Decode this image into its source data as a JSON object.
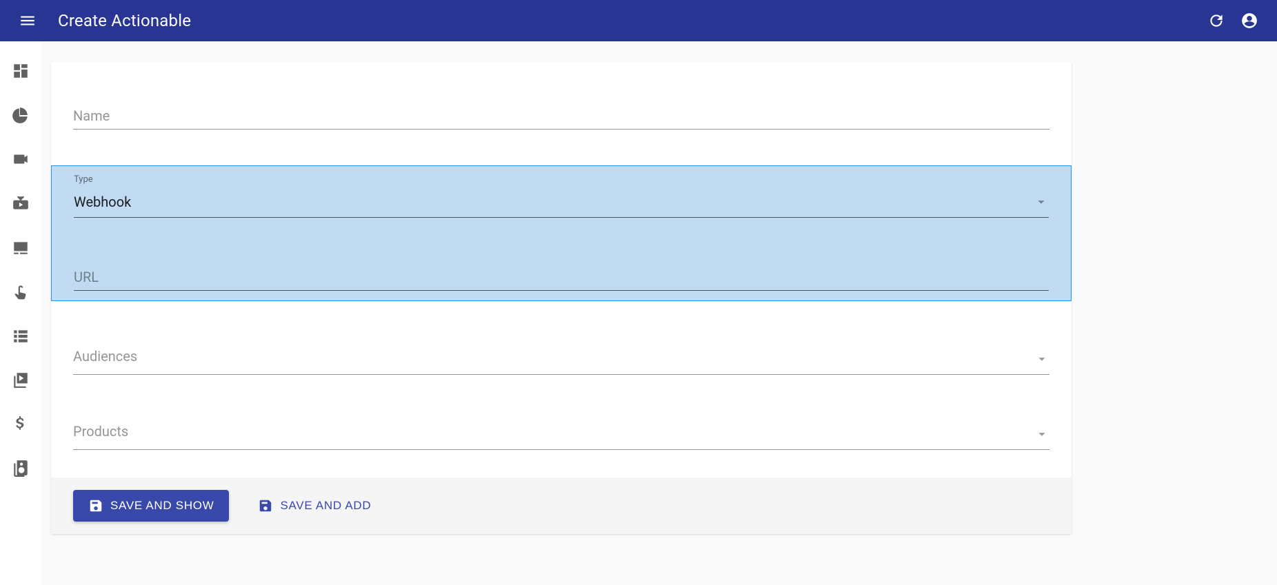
{
  "appbar": {
    "title": "Create Actionable"
  },
  "nav": {
    "items": [
      {
        "name": "dashboard-icon"
      },
      {
        "name": "pie-chart-icon"
      },
      {
        "name": "video-icon"
      },
      {
        "name": "live-tv-icon"
      },
      {
        "name": "subtitles-icon"
      },
      {
        "name": "touch-icon"
      },
      {
        "name": "list-icon"
      },
      {
        "name": "video-library-icon"
      },
      {
        "name": "dollar-icon"
      },
      {
        "name": "speaker-icon"
      }
    ]
  },
  "form": {
    "name": {
      "label": "Name",
      "value": ""
    },
    "type": {
      "label": "Type",
      "value": "Webhook"
    },
    "url": {
      "label": "URL",
      "value": ""
    },
    "audiences": {
      "label": "Audiences",
      "value": ""
    },
    "products": {
      "label": "Products",
      "value": ""
    }
  },
  "actions": {
    "save_show": "SAVE AND SHOW",
    "save_add": "SAVE AND ADD"
  }
}
